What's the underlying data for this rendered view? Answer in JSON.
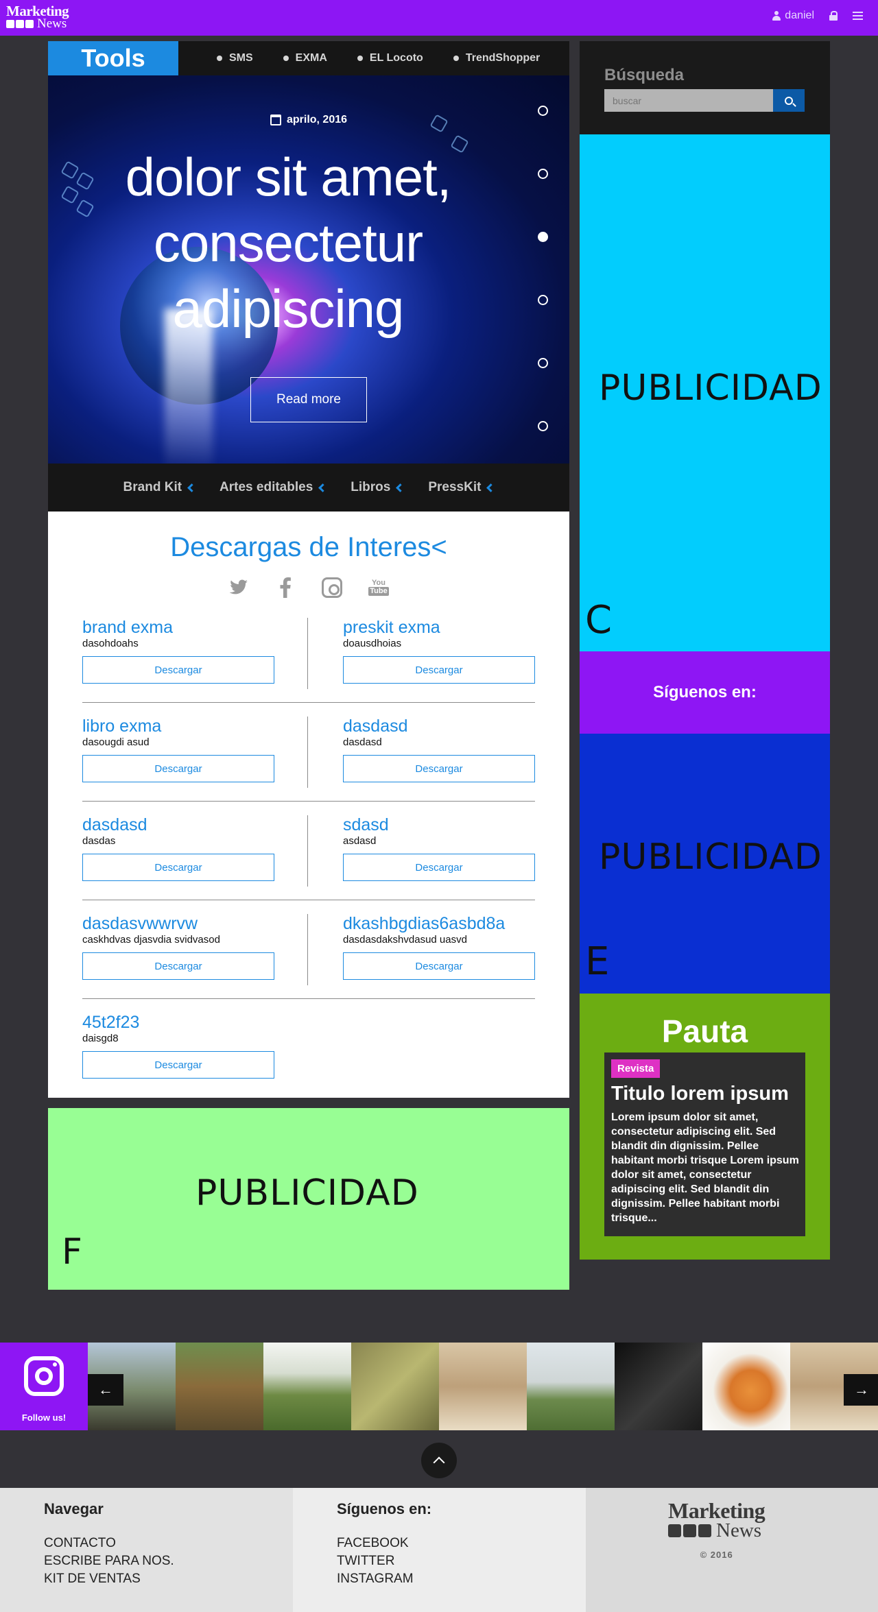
{
  "topbar": {
    "logo_line1": "Marketing",
    "logo_line2": "News",
    "user_name": "daniel"
  },
  "tools": {
    "tab_label": "Tools",
    "nav": [
      "SMS",
      "EXMA",
      "EL Locoto",
      "TrendShopper"
    ]
  },
  "hero": {
    "date": "aprilo, 2016",
    "title": "dolor sit amet, consectetur adipiscing",
    "button_label": "Read more",
    "slide_count": 6,
    "active_slide": 3
  },
  "sub_nav": [
    "Brand Kit",
    "Artes editables",
    "Libros",
    "PressKit"
  ],
  "downloads": {
    "title": "Descargas de Interes<",
    "social_icons": [
      "twitter-icon",
      "facebook-icon",
      "instagram-icon",
      "youtube-icon"
    ],
    "youtube_text_1": "You",
    "youtube_text_2": "Tube",
    "button_label": "Descargar",
    "items": [
      {
        "name": "brand exma",
        "desc": "dasohdoahs"
      },
      {
        "name": "preskit exma",
        "desc": "doausdhoias"
      },
      {
        "name": "libro exma",
        "desc": "dasougdi asud"
      },
      {
        "name": "dasdasd",
        "desc": "dasdasd"
      },
      {
        "name": "dasdasd",
        "desc": "dasdas"
      },
      {
        "name": "sdasd",
        "desc": "asdasd"
      },
      {
        "name": "dasdasvwwrvw",
        "desc": "caskhdvas djasvdia svidvasod"
      },
      {
        "name": "dkashbgdias6asbd8a",
        "desc": "dasdasdakshvdasud uasvd"
      },
      {
        "name": "45t2f23",
        "desc": "daisgd8"
      }
    ]
  },
  "ads": {
    "c": {
      "text": "PUBLICIDAD",
      "letter": "C",
      "color": "#02cdfd"
    },
    "e": {
      "text": "PUBLICIDAD",
      "letter": "E",
      "color": "#0a2fd2"
    },
    "f": {
      "text": "PUBLICIDAD",
      "letter": "F",
      "color": "#98fe94"
    }
  },
  "sidebar": {
    "search_label": "Búsqueda",
    "search_placeholder": "buscar",
    "follow_label": "Síguenos en:",
    "pauta": {
      "title": "Pauta",
      "badge": "Revista",
      "card_title": "Titulo lorem ipsum",
      "card_text": "Lorem ipsum dolor sit amet, consectetur adipiscing elit. Sed blandit din dignissim. Pellee habitant morbi trisque Lorem ipsum dolor sit amet, consectetur adipiscing elit. Sed blandit din dignissim. Pellee habitant morbi trisque..."
    }
  },
  "instagram": {
    "follow_label": "Follow us!",
    "prev_label": "←",
    "next_label": "→"
  },
  "footer": {
    "nav_title": "Navegar",
    "nav_links": [
      "CONTACTO",
      "ESCRIBE PARA NOS.",
      "KIT DE VENTAS"
    ],
    "follow_title": "Síguenos en:",
    "follow_links": [
      "FACEBOOK",
      "TWITTER",
      "INSTAGRAM"
    ],
    "logo_line1": "Marketing",
    "logo_line2": "News",
    "copyright": "© 2016"
  },
  "colors": {
    "brand_purple": "#8d16f4",
    "accent_blue": "#1c8ae0",
    "pauta_green": "#6cad12",
    "badge_pink": "#de31c4"
  }
}
